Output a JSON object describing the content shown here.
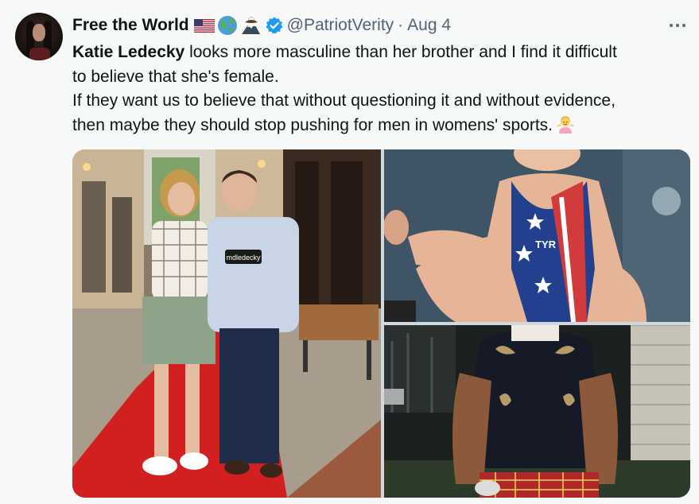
{
  "author": {
    "display_name": "Free the World",
    "handle": "@PatriotVerity",
    "separator": "·",
    "timestamp": "Aug 4",
    "name_emojis": [
      "us-flag-icon",
      "globe-icon",
      "eagle-mountain-icon"
    ],
    "verified": true
  },
  "tweet": {
    "mention_name": "Katie Ledecky",
    "line1_rest": " looks more masculine than her brother and I find it difficult",
    "line2": "to believe that she's female.",
    "line3": "If they want us to believe that without questioning it and without evidence,",
    "line4": "then maybe they should stop pushing for men in womens' sports.",
    "trailing_emoji": "person-shrugging-emoji"
  },
  "media": {
    "photo1": {
      "badge_text": "mdledecky"
    },
    "photo2": {
      "suit_logo": "TYR"
    }
  },
  "colors": {
    "accent": "#1d9bf0",
    "text": "#0f1419",
    "secondary": "#536471",
    "background": "#f7f9f9"
  }
}
